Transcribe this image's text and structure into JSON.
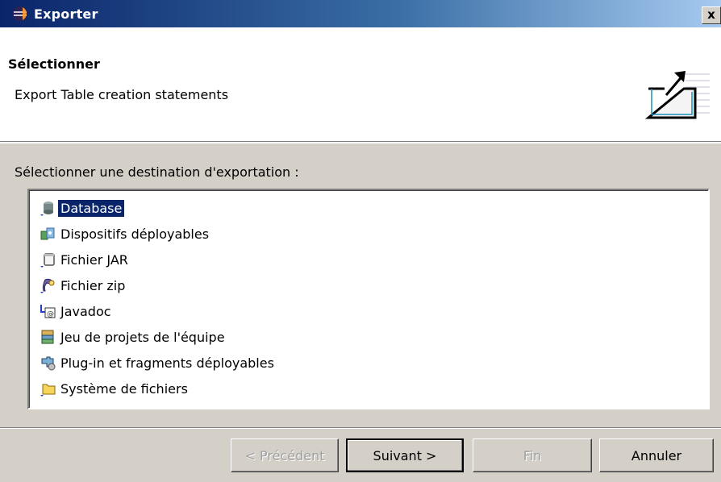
{
  "window": {
    "title": "Exporter",
    "close_label": "x"
  },
  "header": {
    "heading": "Sélectionner",
    "description": "Export Table creation statements"
  },
  "destination_label": "Sélectionner une destination d'exportation :",
  "items": [
    {
      "label": "Database",
      "icon": "database-icon",
      "selected": true
    },
    {
      "label": "Dispositifs déployables",
      "icon": "deployable-features-icon"
    },
    {
      "label": "Fichier JAR",
      "icon": "jar-file-icon"
    },
    {
      "label": "Fichier zip",
      "icon": "zip-file-icon"
    },
    {
      "label": "Javadoc",
      "icon": "javadoc-icon"
    },
    {
      "label": "Jeu de projets de l'équipe",
      "icon": "team-project-set-icon"
    },
    {
      "label": "Plug-in et fragments déployables",
      "icon": "plugin-fragments-icon"
    },
    {
      "label": "Système de fichiers",
      "icon": "folder-icon"
    }
  ],
  "buttons": {
    "back": "< Précédent",
    "next": "Suivant >",
    "finish": "Fin",
    "cancel": "Annuler"
  },
  "colors": {
    "selection": "#0a246a",
    "dialog_bg": "#d4d0c8"
  }
}
